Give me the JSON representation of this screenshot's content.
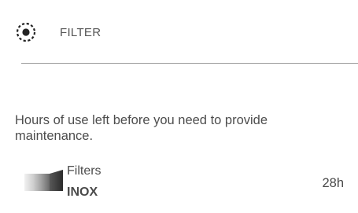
{
  "header": {
    "icon": "filter-target-icon",
    "title": "FILTER"
  },
  "description": "Hours of use left before you need to provide maintenance.",
  "items": [
    {
      "thumbnail": "filter-cartridge-image",
      "title": "Filters",
      "subtitle": "INOX",
      "value": "28h"
    }
  ]
}
